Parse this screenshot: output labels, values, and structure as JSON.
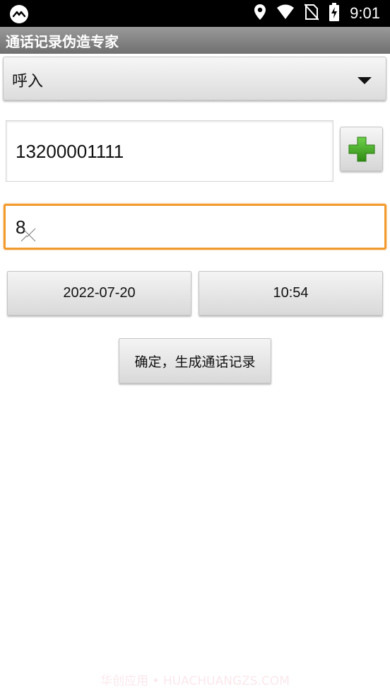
{
  "status_bar": {
    "time": "9:01",
    "icons": [
      "app-notification-icon",
      "location-icon",
      "wifi-icon",
      "no-sim-icon",
      "battery-charging-icon"
    ]
  },
  "title_bar": {
    "title": "通话记录伪造专家"
  },
  "call_type_spinner": {
    "selected": "呼入"
  },
  "phone_field": {
    "value": "13200001111"
  },
  "add_button": {
    "icon": "plus-icon",
    "icon_color": "#3fa71f"
  },
  "duration_field": {
    "value": "8",
    "accent_color": "#f29b2d"
  },
  "date_button": {
    "label": "2022-07-20"
  },
  "time_button": {
    "label": "10:54"
  },
  "confirm_button": {
    "label": "确定，生成通话记录"
  },
  "watermark": {
    "text": "华创应用 • HUACHUANGZS.COM"
  }
}
